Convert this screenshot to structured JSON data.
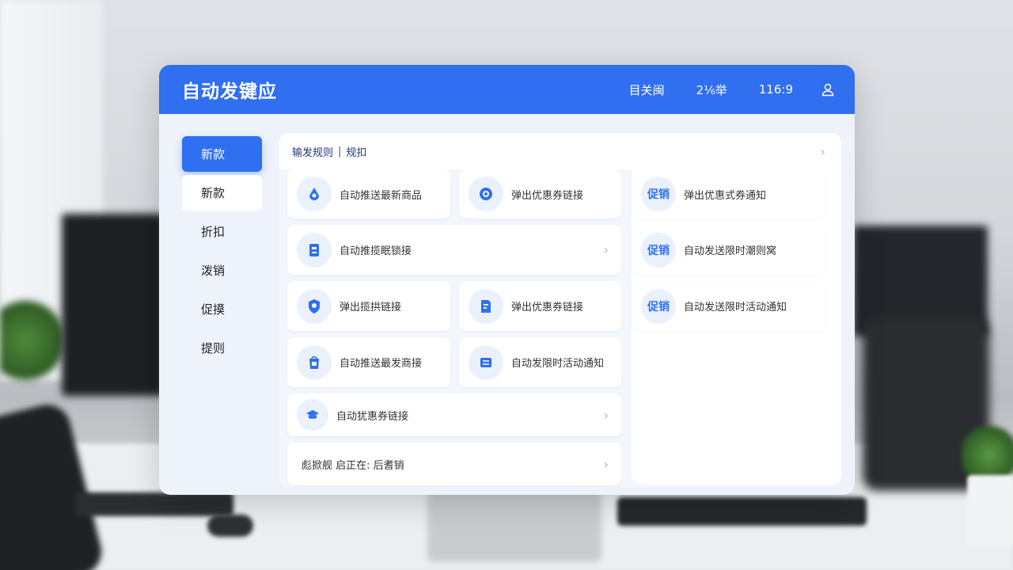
{
  "app": {
    "title": "自动发键应"
  },
  "topbar": {
    "item1": "目关闽",
    "item2": "2⅙举",
    "item3": "116:9",
    "user_icon": "user-icon"
  },
  "sidebar": {
    "items": [
      {
        "label": "新款"
      },
      {
        "label": "新款"
      },
      {
        "label": "折扣"
      },
      {
        "label": "泼销"
      },
      {
        "label": "促摸"
      },
      {
        "label": "提则"
      }
    ]
  },
  "breadcrumb": {
    "part1": "输发规则",
    "sep": "|",
    "part2": "规扣"
  },
  "cards": {
    "c1": {
      "label": "自动推送最新商品",
      "icon": "drop-icon"
    },
    "c2": {
      "label": "弹出优惠券链接",
      "icon": "target-icon"
    },
    "c3": {
      "label": "弹出优惠式券通知",
      "tag": "促销"
    },
    "c4": {
      "label": "自动推揽眠锁接",
      "icon": "document-icon"
    },
    "c5": {
      "label": "自动发送限时潮则窝",
      "tag": "促销"
    },
    "c6": {
      "label": "弹出揽拱链接",
      "icon": "shield-icon"
    },
    "c7": {
      "label": "弹出优惠券链接",
      "icon": "file-icon"
    },
    "c8": {
      "label": "自动发送限时活动通知",
      "tag": "促销"
    },
    "c9": {
      "label": "自动推送最发商接",
      "icon": "bag-icon"
    },
    "c10": {
      "label": "自动发限时活动通知",
      "icon": "transfer-icon"
    },
    "c11": {
      "label": "自动犹惠券链接",
      "icon": "cap-icon"
    },
    "c12": {
      "label": "彪掀舰 启正在: 后耆销"
    }
  },
  "colors": {
    "primary": "#2f6ff0",
    "panel": "#eef3fb"
  }
}
